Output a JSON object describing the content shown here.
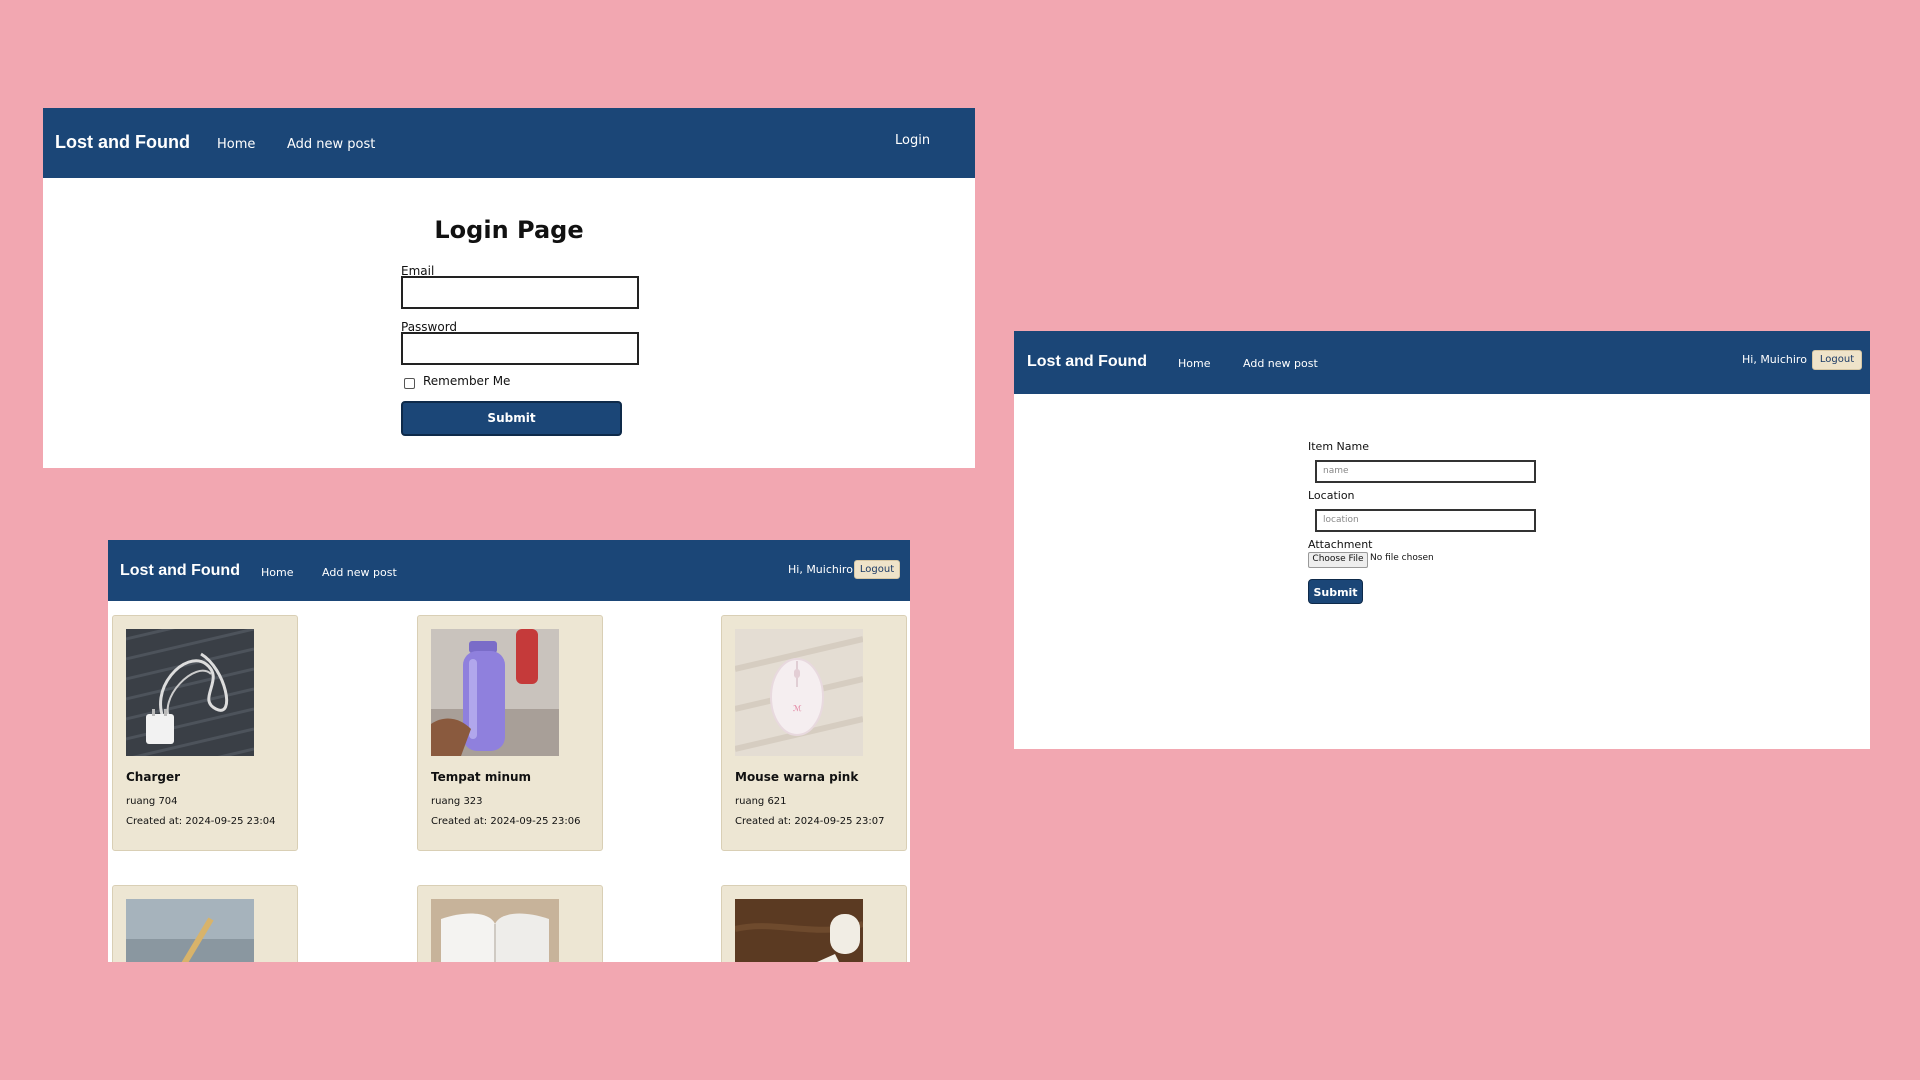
{
  "colors": {
    "background": "#f2a7b1",
    "navbar": "#1b4677",
    "card": "#ede6d3",
    "logout": "#efe3c9"
  },
  "login_screen": {
    "nav": {
      "brand": "Lost and Found",
      "home": "Home",
      "add_post": "Add new post",
      "login": "Login"
    },
    "title": "Login Page",
    "email_label": "Email",
    "password_label": "Password",
    "remember_label": "Remember Me",
    "submit_label": "Submit"
  },
  "list_screen": {
    "nav": {
      "brand": "Lost and Found",
      "home": "Home",
      "add_post": "Add new post",
      "greeting": "Hi, Muichiro",
      "logout": "Logout"
    },
    "cards": [
      {
        "title": "Charger",
        "location": "ruang 704",
        "created": "Created at: 2024-09-25 23:04",
        "image": "charger-photo"
      },
      {
        "title": "Tempat minum",
        "location": "ruang 323",
        "created": "Created at: 2024-09-25 23:06",
        "image": "bottle-photo"
      },
      {
        "title": "Mouse warna pink",
        "location": "ruang 621",
        "created": "Created at: 2024-09-25 23:07",
        "image": "mouse-photo"
      },
      {
        "title": "",
        "location": "",
        "created": "",
        "image": "pen-photo"
      },
      {
        "title": "",
        "location": "",
        "created": "",
        "image": "notebook-photo"
      },
      {
        "title": "",
        "location": "",
        "created": "",
        "image": "usb-photo"
      }
    ]
  },
  "post_screen": {
    "nav": {
      "brand": "Lost and Found",
      "home": "Home",
      "add_post": "Add new post",
      "greeting": "Hi, Muichiro",
      "logout": "Logout"
    },
    "item_name_label": "Item Name",
    "item_name_placeholder": "name",
    "location_label": "Location",
    "location_placeholder": "location",
    "attachment_label": "Attachment",
    "choose_file": "Choose File",
    "no_file": "No file chosen",
    "submit_label": "Submit"
  }
}
